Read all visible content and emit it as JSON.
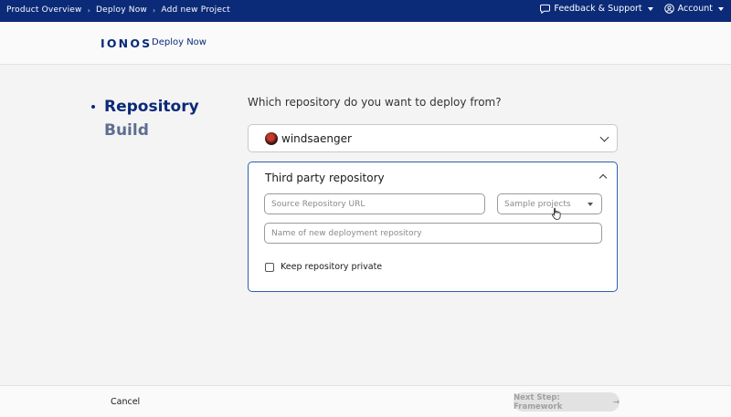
{
  "topbar": {
    "breadcrumbs": [
      "Product Overview",
      "Deploy Now",
      "Add new Project"
    ],
    "feedback_label": "Feedback & Support",
    "account_label": "Account"
  },
  "header": {
    "logo": "IONOS",
    "product": "Deploy Now"
  },
  "steps": {
    "active": "Repository",
    "next": "Build"
  },
  "main": {
    "question": "Which repository do you want to deploy from?",
    "owner": "windsaenger",
    "third_party": {
      "title": "Third party repository",
      "url_placeholder": "Source Repository URL",
      "sample_placeholder": "Sample projects",
      "name_placeholder": "Name of new deployment repository",
      "private_label": "Keep repository private",
      "private_checked": false
    }
  },
  "footer": {
    "cancel_label": "Cancel",
    "next_label": "Next Step: Framework",
    "next_arrow": "→",
    "next_enabled": false
  },
  "colors": {
    "brand": "#0b2a78",
    "accent_border": "#2e5fb0",
    "disabled": "#e2e2e2"
  }
}
